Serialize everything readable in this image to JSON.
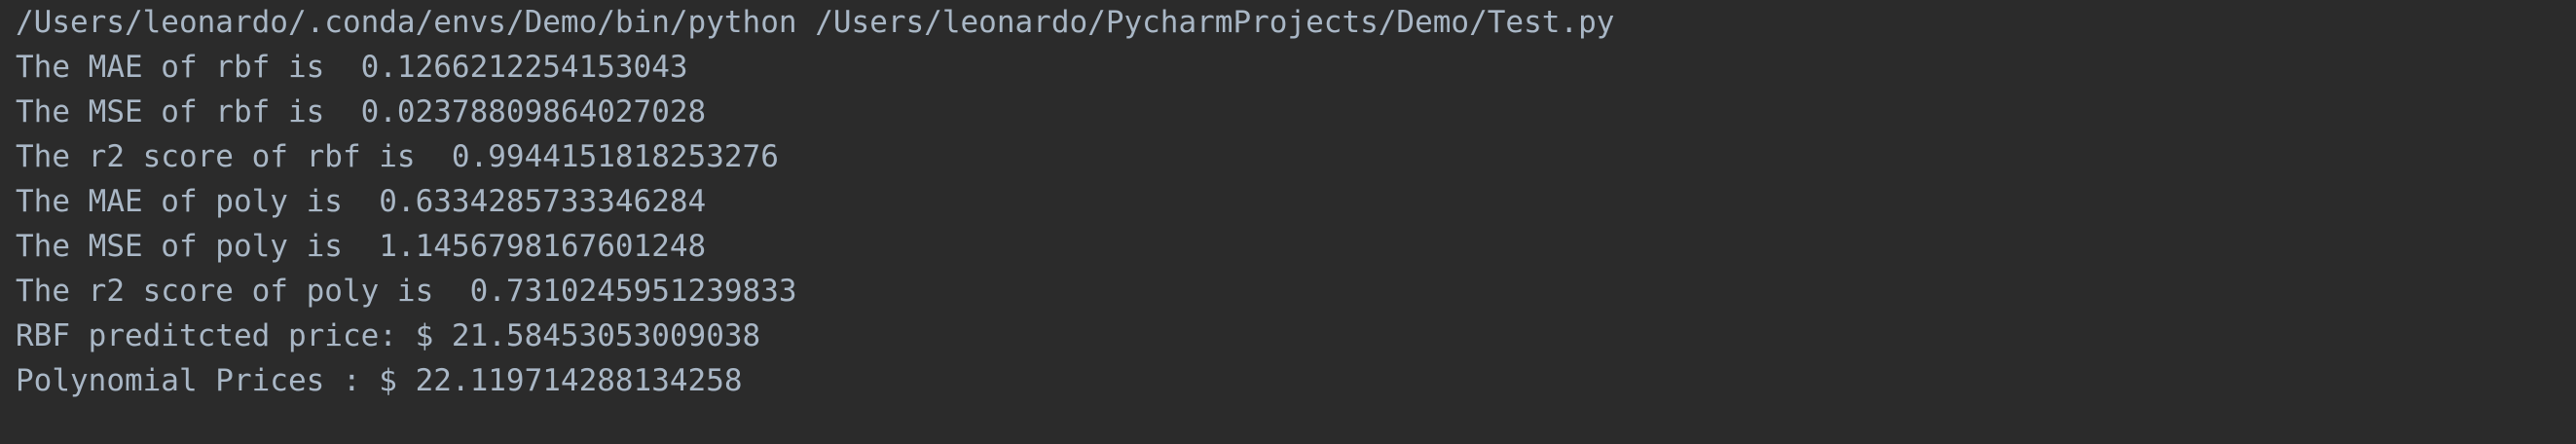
{
  "console": {
    "command": "/Users/leonardo/.conda/envs/Demo/bin/python /Users/leonardo/PycharmProjects/Demo/Test.py",
    "output": [
      "The MAE of rbf is  0.1266212254153043",
      "The MSE of rbf is  0.02378809864027028",
      "The r2 score of rbf is  0.9944151818253276",
      "The MAE of poly is  0.6334285733346284",
      "The MSE of poly is  1.1456798167601248",
      "The r2 score of poly is  0.7310245951239833",
      "RBF preditcted price: $ 21.58453053009038",
      "Polynomial Prices : $ 22.119714288134258"
    ]
  },
  "colors": {
    "background": "#2b2b2b",
    "text": "#a9b7c6"
  }
}
